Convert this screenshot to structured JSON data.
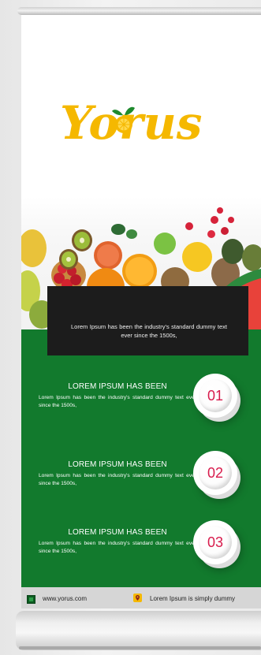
{
  "brand": {
    "name": "Yorus",
    "logo_color": "#f5b800",
    "leaf_color": "#1e8a2d"
  },
  "intro": {
    "text": "Lorem Ipsum has been the industry's standard dummy text ever since the 1500s,"
  },
  "items": [
    {
      "heading": "LOREM IPSUM HAS BEEN",
      "body": "Lorem Ipsum has been the industry's standard dummy text ever since the 1500s,",
      "number": "01"
    },
    {
      "heading": "LOREM IPSUM HAS BEEN",
      "body": "Lorem Ipsum has been the industry's standard dummy text ever since the 1500s,",
      "number": "02"
    },
    {
      "heading": "LOREM IPSUM HAS BEEN",
      "body": "Lorem Ipsum has been the industry's standard dummy text ever since the 1500s,",
      "number": "03"
    }
  ],
  "footer": {
    "website": "www.yorus.com",
    "address": "Lorem Ipsum is simply dummy",
    "web_icon": "web-icon",
    "pin_icon": "location-pin-icon"
  },
  "colors": {
    "panel_green": "#127a2d",
    "dark_box": "#1c1c1c",
    "number_red": "#d81b4c",
    "footer_bg": "#d6d6d6"
  }
}
